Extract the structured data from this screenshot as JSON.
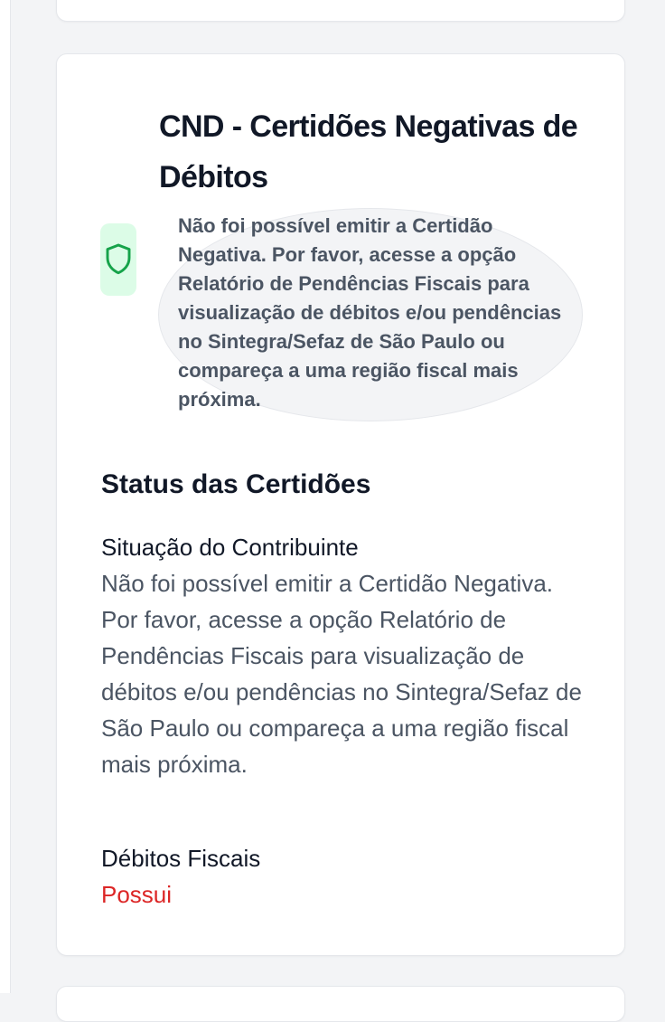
{
  "card": {
    "title": "CND - Certidões Negativas de Débitos",
    "icon": "shield-icon",
    "notice": "Não foi possível emitir a Certidão Negativa. Por favor, acesse a opção Relatório de Pendências Fiscais para visualização de débitos e/ou pendências no Sintegra/Sefaz de São Paulo ou compareça a uma região fiscal mais próxima."
  },
  "status": {
    "heading": "Status das Certidões",
    "fields": [
      {
        "label": "Situação do Contribuinte",
        "value": "Não foi possível emitir a Certidão Negativa. Por favor, acesse a opção Relatório de Pendências Fiscais para visualização de débitos e/ou pendências no Sintegra/Sefaz de São Paulo ou compareça a uma região fiscal mais próxima."
      },
      {
        "label": "Débitos Fiscais",
        "value": "Possui",
        "value_color": "#dc2626"
      }
    ]
  },
  "colors": {
    "background": "#f3f4f6",
    "icon_tile": "#dcfce7",
    "icon_stroke": "#16a34a",
    "negative": "#dc2626"
  }
}
